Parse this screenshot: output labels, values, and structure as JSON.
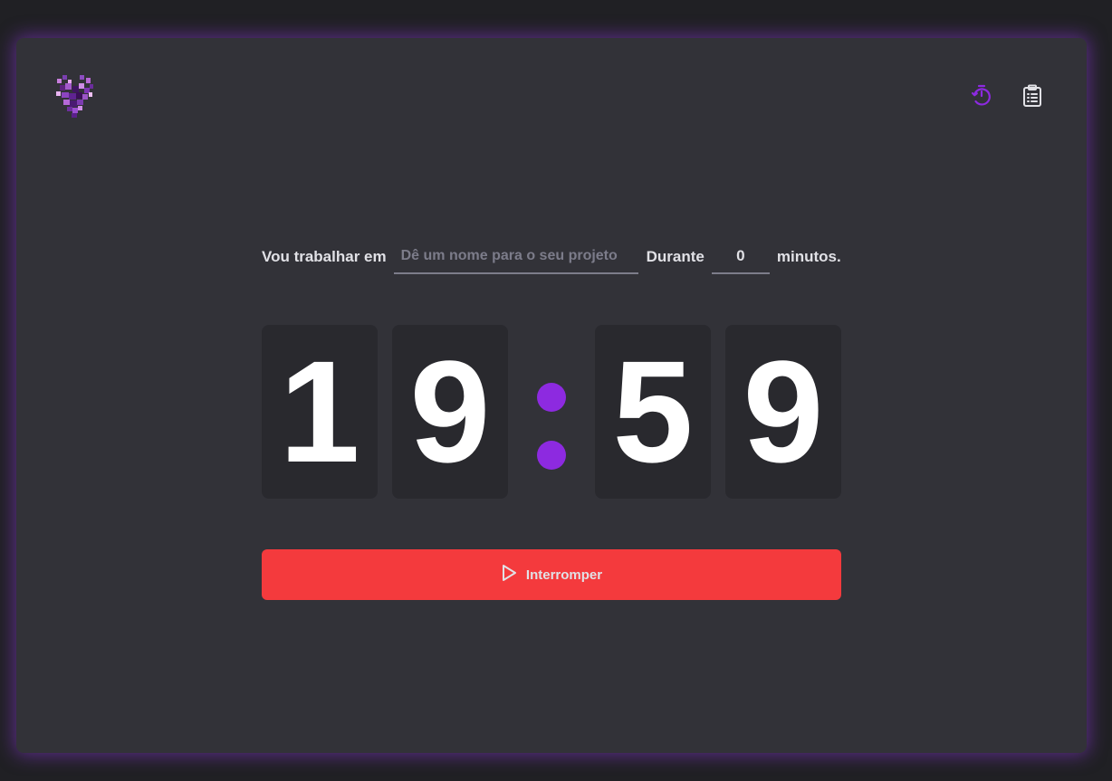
{
  "header": {
    "logo": "pixel-heart-logo",
    "nav": [
      {
        "icon": "timer-icon",
        "active": true,
        "color": "#8d2ae0"
      },
      {
        "icon": "clipboard-list-icon",
        "active": false,
        "color": "#e1e1e6"
      }
    ]
  },
  "form": {
    "task_label": "Vou trabalhar em",
    "task_value": "",
    "task_placeholder": "Dê um nome para o seu projeto",
    "duration_label": "Durante",
    "minutes_value": "0",
    "minutes_suffix": "minutos."
  },
  "countdown": {
    "minutes_tens": "1",
    "minutes_ones": "9",
    "seconds_tens": "5",
    "seconds_ones": "9"
  },
  "button": {
    "label": "Interromper",
    "icon": "play-icon"
  },
  "colors": {
    "accent": "#8d2ae0",
    "danger": "#f43a3d",
    "background": "#202024",
    "panel": "#323238",
    "digit_background": "#29292e"
  }
}
